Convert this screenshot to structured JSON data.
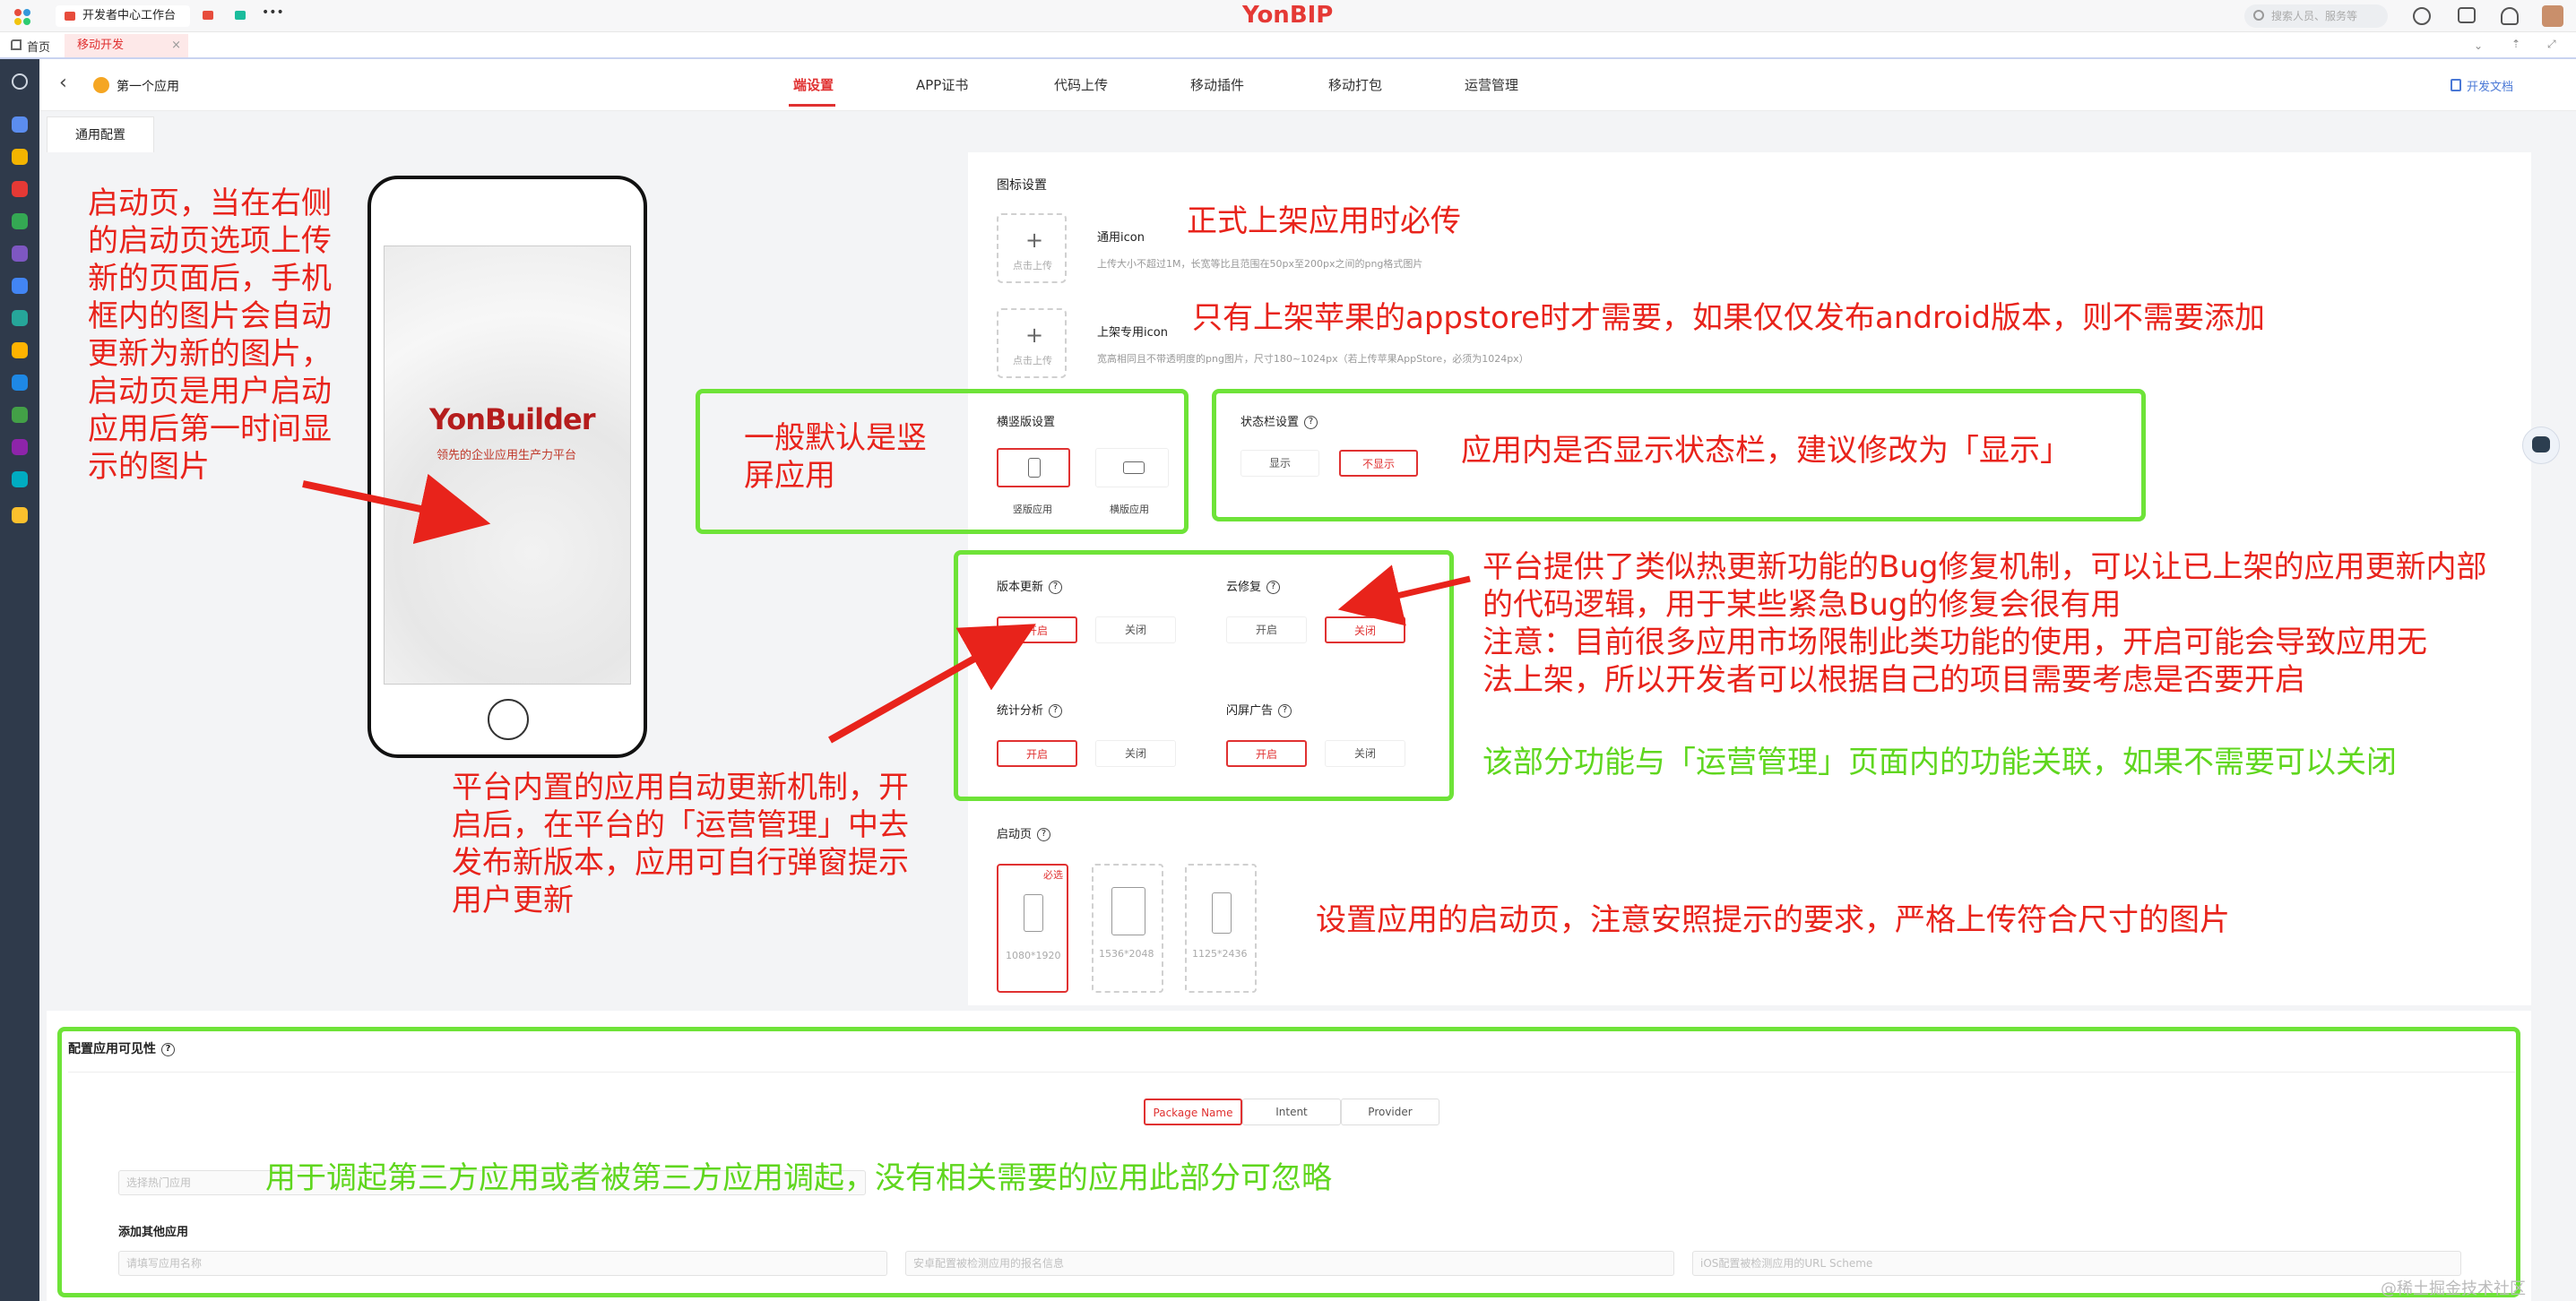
{
  "topbar": {
    "tab1": "开发者中心工作台",
    "more": "•••",
    "brand": "YonBIP",
    "search_placeholder": "搜索人员、服务等"
  },
  "tabbar": {
    "home": "首页",
    "active_tab": "移动开发",
    "close": "×"
  },
  "app": {
    "back": "‹",
    "name": "第一个应用",
    "nav": [
      "端设置",
      "APP证书",
      "代码上传",
      "移动插件",
      "移动打包",
      "运营管理"
    ],
    "docs": "开发文档",
    "subtab": "通用配置"
  },
  "phone": {
    "brand": "YonBuilder",
    "slogan": "领先的企业应用生产力平台"
  },
  "icon_settings": {
    "title": "图标设置",
    "upload": "点击上传",
    "general_label": "通用icon",
    "general_hint": "上传大小不超过1M，长宽等比且范围在50px至200px之间的png格式图片",
    "store_label": "上架专用icon",
    "store_hint": "宽高相同且不带透明度的png图片，尺寸180~1024px（若上传苹果AppStore，必须为1024px）"
  },
  "orientation": {
    "title": "横竖版设置",
    "portrait": "竖版应用",
    "landscape": "横版应用"
  },
  "statusbar": {
    "title": "状态栏设置",
    "show": "显示",
    "hide": "不显示"
  },
  "features": {
    "version_update": "版本更新",
    "cloud_fix": "云修复",
    "stats": "统计分析",
    "splash_ad": "闪屏广告",
    "on": "开启",
    "off": "关闭"
  },
  "launch": {
    "title": "启动页",
    "required": "必选",
    "sizes": [
      "1080*1920",
      "1536*2048",
      "1125*2436"
    ]
  },
  "visibility": {
    "title": "配置应用可见性",
    "tabs": [
      "Package Name",
      "Intent",
      "Provider"
    ],
    "select_placeholder": "选择热门应用",
    "add_other": "添加其他应用",
    "app_name_placeholder": "请填写应用名称",
    "pkg_placeholder": "安卓配置被检测应用的报名信息",
    "scheme_placeholder": "iOS配置被检测应用的URL Scheme"
  },
  "annotations": {
    "launch_left": "启动页，当在右侧的启动页选项上传新的页面后，手机框内的图片会自动更新为新的图片，启动页是用户启动应用后第一时间显示的图片",
    "general_icon": "正式上架应用时必传",
    "store_icon": "只有上架苹果的appstore时才需要，如果仅仅发布android版本，则不需要添加",
    "orientation": "一般默认是竖屏应用",
    "statusbar": "应用内是否显示状态栏，建议修改为「显示」",
    "cloudfix": "平台提供了类似热更新功能的Bug修复机制，可以让已上架的应用更新内部的代码逻辑，用于某些紧急Bug的修复会很有用",
    "cloudfix_note": "注意：目前很多应用市场限制此类功能的使用，开启可能会导致应用无法上架，所以开发者可以根据自己的项目需要考虑是否要开启",
    "ops_note": "该部分功能与「运营管理」页面内的功能关联，如果不需要可以关闭",
    "auto_update": "平台内置的应用自动更新机制，开启后，在平台的「运营管理」中去发布新版本，应用可自行弹窗提示用户更新",
    "launch_right": "设置应用的启动页，注意安照提示的要求，严格上传符合尺寸的图片",
    "visibility_note": "用于调起第三方应用或者被第三方应用调起，没有相关需要的应用此部分可忽略"
  },
  "watermark": "@稀土掘金技术社区",
  "colors": {
    "accent": "#e03131",
    "annotation_red": "#e8231b",
    "annotation_green": "#5fd61e",
    "frame_green": "#6ee338"
  }
}
